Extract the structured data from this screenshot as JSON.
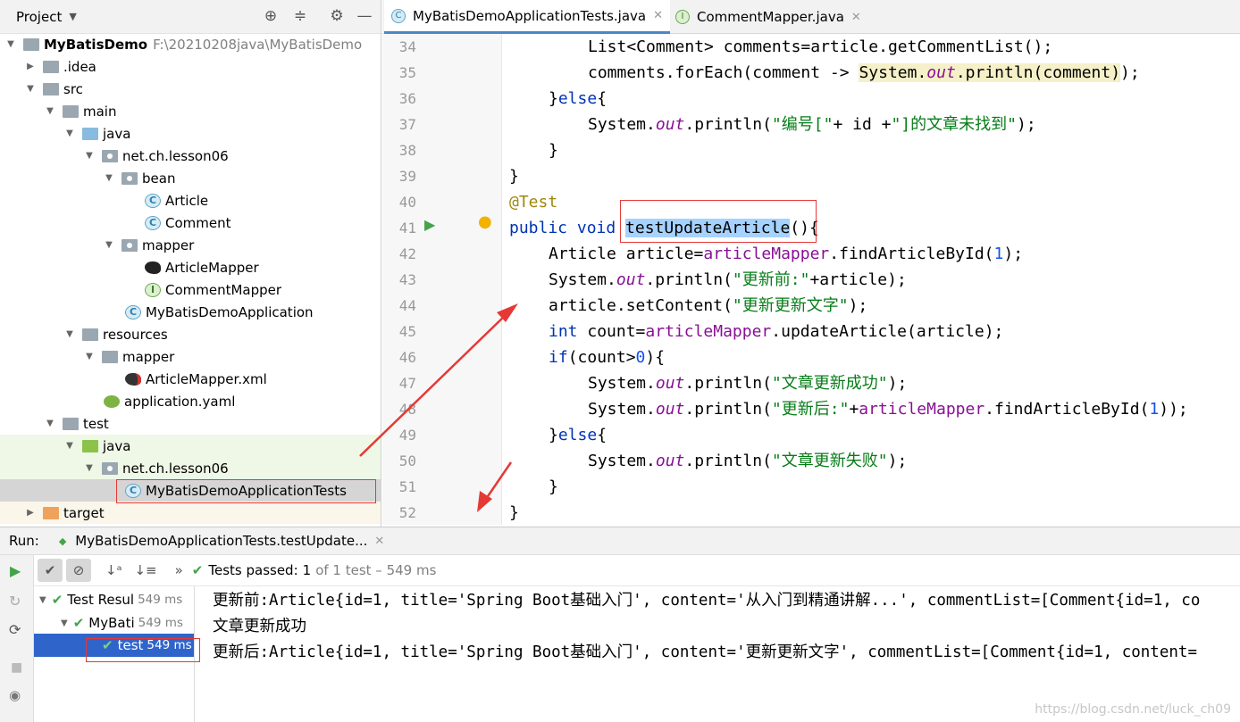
{
  "project": {
    "title": "Project",
    "tree": [
      {
        "label": "MyBatisDemo",
        "path": "F:\\20210208java\\MyBatisDemo",
        "icon": "module-folder-icon"
      },
      {
        "label": ".idea",
        "icon": "folder-icon"
      },
      {
        "label": "src",
        "icon": "folder-icon"
      },
      {
        "label": "main",
        "icon": "folder-icon"
      },
      {
        "label": "java",
        "icon": "source-folder-icon"
      },
      {
        "label": "net.ch.lesson06",
        "icon": "package-icon"
      },
      {
        "label": "bean",
        "icon": "package-icon"
      },
      {
        "label": "Article",
        "icon": "class-icon"
      },
      {
        "label": "Comment",
        "icon": "class-icon"
      },
      {
        "label": "mapper",
        "icon": "package-icon"
      },
      {
        "label": "ArticleMapper",
        "icon": "mybatis-icon"
      },
      {
        "label": "CommentMapper",
        "icon": "interface-icon"
      },
      {
        "label": "MyBatisDemoApplication",
        "icon": "spring-class-icon"
      },
      {
        "label": "resources",
        "icon": "resources-folder-icon"
      },
      {
        "label": "mapper",
        "icon": "folder-icon"
      },
      {
        "label": "ArticleMapper.xml",
        "icon": "mybatis-xml-icon"
      },
      {
        "label": "application.yaml",
        "icon": "yaml-icon"
      },
      {
        "label": "test",
        "icon": "folder-icon"
      },
      {
        "label": "java",
        "icon": "test-folder-icon"
      },
      {
        "label": "net.ch.lesson06",
        "icon": "package-icon"
      },
      {
        "label": "MyBatisDemoApplicationTests",
        "icon": "spring-class-icon"
      },
      {
        "label": "target",
        "icon": "excluded-folder-icon"
      }
    ]
  },
  "editor": {
    "tabs": [
      {
        "label": "MyBatisDemoApplicationTests.java",
        "close": "✕"
      },
      {
        "label": "CommentMapper.java",
        "close": "✕"
      }
    ],
    "line_numbers": [
      "34",
      "35",
      "36",
      "37",
      "38",
      "39",
      "40",
      "41",
      "42",
      "43",
      "44",
      "45",
      "46",
      "47",
      "48",
      "49",
      "50",
      "51",
      "52"
    ],
    "code": {
      "l34a": "List<Comment> comments=article.getCommentList();",
      "l35a": "comments.forEach(comment -> ",
      "l35b": "System.",
      "l35c": "out",
      "l35d": ".println(comment)",
      "l35e": ");",
      "l36a": "}",
      "l36b": "else",
      "l36c": "{",
      "l37a": "System.",
      "l37b": "out",
      "l37c": ".println(",
      "l37d": "\"编号[\"",
      "l37e": "+ id +",
      "l37f": "\"]的文章未找到\"",
      "l37g": ");",
      "l38a": "}",
      "l39a": "}",
      "l40a": "@Test",
      "l41a": "public void ",
      "l41b": "testUpdateArticle",
      "l41c": "()",
      "l41d": "{",
      "l42a": "Article article=",
      "l42b": "articleMapper",
      "l42c": ".findArticleById(",
      "l42d": "1",
      "l42e": ");",
      "l43a": "System.",
      "l43b": "out",
      "l43c": ".println(",
      "l43d": "\"更新前:\"",
      "l43e": "+article);",
      "l44a": "article.setContent(",
      "l44b": "\"更新更新文字\"",
      "l44c": ");",
      "l45a": "int ",
      "l45b": "count=",
      "l45c": "articleMapper",
      "l45d": ".updateArticle(article);",
      "l46a": "if",
      "l46b": "(count>",
      "l46c": "0",
      "l46d": "){",
      "l47a": "System.",
      "l47b": "out",
      "l47c": ".println(",
      "l47d": "\"文章更新成功\"",
      "l47e": ");",
      "l48a": "System.",
      "l48b": "out",
      "l48c": ".println(",
      "l48d": "\"更新后:\"",
      "l48e": "+",
      "l48f": "articleMapper",
      "l48g": ".findArticleById(",
      "l48h": "1",
      "l48i": "));",
      "l49a": "}",
      "l49b": "else",
      "l49c": "{",
      "l50a": "System.",
      "l50b": "out",
      "l50c": ".println(",
      "l50d": "\"文章更新失败\"",
      "l50e": ");",
      "l51a": "}",
      "l52a": "}"
    }
  },
  "run": {
    "label": "Run:",
    "tab_label": "MyBatisDemoApplicationTests.testUpdate...",
    "tab_close": "✕",
    "status_prefix": "Tests passed:",
    "status_count": "1",
    "status_rest": "of 1 test – 549 ms",
    "tree": [
      {
        "label": "Test Resul",
        "time": "549 ms"
      },
      {
        "label": "MyBati",
        "time": "549 ms"
      },
      {
        "label": "test",
        "time": "549 ms"
      }
    ],
    "console": [
      "更新前:Article{id=1, title='Spring Boot基础入门', content='从入门到精通讲解...', commentList=[Comment{id=1, co",
      "文章更新成功",
      "更新后:Article{id=1, title='Spring Boot基础入门', content='更新更新文字', commentList=[Comment{id=1, content="
    ]
  },
  "watermark": "https://blog.csdn.net/luck_ch09",
  "colors": {
    "accent": "#4a88c7",
    "selection": "#2f65ca",
    "pass": "#45a34a",
    "annotation_red": "#e53935"
  }
}
